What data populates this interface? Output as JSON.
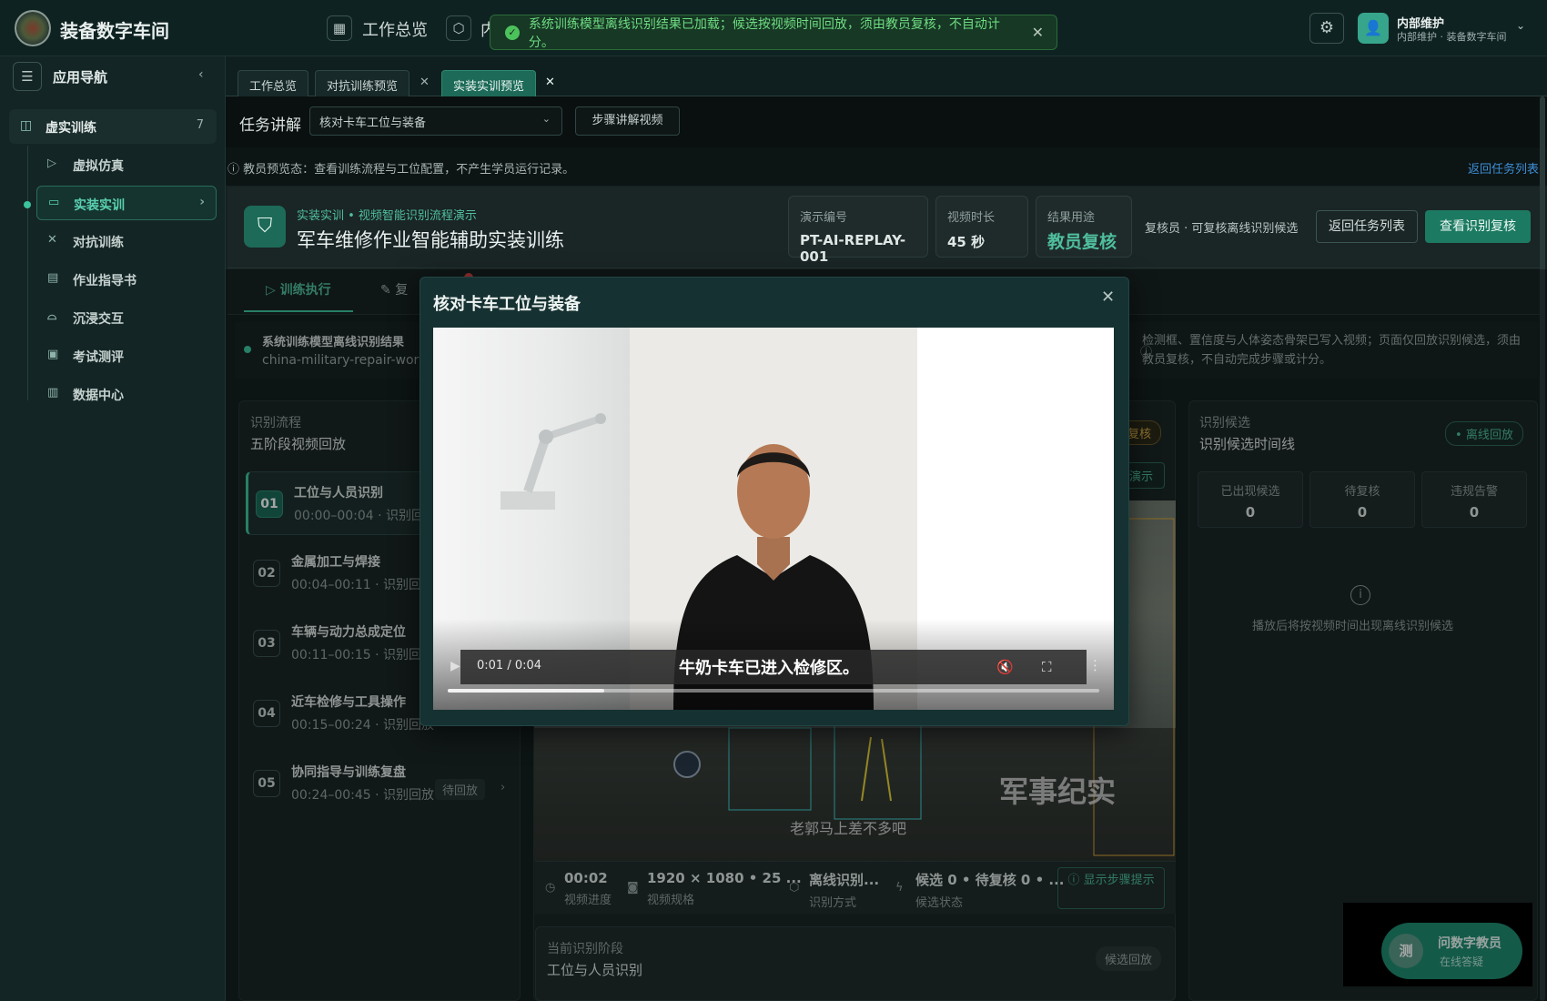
{
  "app": {
    "brand": "装备数字车间"
  },
  "topnav": {
    "overview": "工作总览",
    "internal_partial": "内"
  },
  "toast": {
    "message": "系统训练模型离线识别结果已加载；候选按视频时间回放，须由教员复核，不自动计分。"
  },
  "user": {
    "name": "内部维护",
    "sub": "内部维护 · 装备数字车间"
  },
  "sidebar": {
    "title": "应用导航",
    "group": {
      "label": "虚实训练",
      "count": "7"
    },
    "items": [
      {
        "label": "虚拟仿真"
      },
      {
        "label": "实装实训"
      },
      {
        "label": "对抗训练"
      },
      {
        "label": "作业指导书"
      },
      {
        "label": "沉浸交互"
      },
      {
        "label": "考试测评"
      },
      {
        "label": "数据中心"
      }
    ]
  },
  "tabs": [
    {
      "label": "工作总览"
    },
    {
      "label": "对抗训练预览"
    },
    {
      "label": "实装实训预览"
    }
  ],
  "task": {
    "label": "任务讲解",
    "selected": "核对卡车工位与装备",
    "step_video_btn": "步骤讲解视频"
  },
  "infobar": {
    "text": "教员预览态：查看训练流程与工位配置，不产生学员运行记录。",
    "link": "返回任务列表"
  },
  "header": {
    "crumb": "实装实训 • 视频智能识别流程演示",
    "title": "军车维修作业智能辅助实装训练",
    "stats": [
      {
        "k": "演示编号",
        "v": "PT-AI-REPLAY-001"
      },
      {
        "k": "视频时长",
        "v": "45 秒"
      },
      {
        "k": "结果用途",
        "v": "教员复核"
      }
    ],
    "reviewer": "复核员 · 可复核离线识别候选",
    "back_btn": "返回任务列表",
    "review_btn": "查看识别复核"
  },
  "subtabs": {
    "exec": "训练执行",
    "review_partial": "复"
  },
  "notice": {
    "title": "系统训练模型离线识别结果",
    "sub": "china-military-repair-work",
    "right": "检测框、置信度与人体姿态骨架已写入视频；页面仅回放识别候选，须由教员复核，不自动完成步骤或计分。"
  },
  "flow": {
    "k": "识别流程",
    "v": "五阶段视频回放",
    "steps": [
      {
        "num": "01",
        "name": "工位与人员识别",
        "time": "00:00–00:04 · 识别回放"
      },
      {
        "num": "02",
        "name": "金属加工与焊接",
        "time": "00:04–00:11 · 识别回放"
      },
      {
        "num": "03",
        "name": "车辆与动力总成定位",
        "time": "00:11–00:15 · 识别回放"
      },
      {
        "num": "04",
        "name": "近车检修与工具操作",
        "time": "00:15–00:24 · 识别回放"
      },
      {
        "num": "05",
        "name": "协同指导与训练复盘",
        "time": "00:24–00:45 · 识别回放",
        "pending": "待回放"
      }
    ]
  },
  "video": {
    "badge_review": "复核",
    "badge_demo": "演示",
    "watermark": "军事纪实",
    "subtitle": "老郭马上差不多吧",
    "meta": [
      {
        "v": "00:02",
        "k": "视频进度"
      },
      {
        "v": "1920 × 1080 • 25 ...",
        "k": "视频规格"
      },
      {
        "v": "离线识别...",
        "k": "识别方式"
      },
      {
        "v": "候选 0 • 待复核 0 • ...",
        "k": "候选状态"
      }
    ],
    "show_btn": "显示步骤提示"
  },
  "stage": {
    "k": "当前识别阶段",
    "v": "工位与人员识别",
    "badge": "候选回放"
  },
  "candidates": {
    "k": "识别候选",
    "v": "识别候选时间线",
    "badge": "离线回放",
    "counts": [
      {
        "k": "已出现候选",
        "v": "0"
      },
      {
        "k": "待复核",
        "v": "0"
      },
      {
        "k": "违规告警",
        "v": "0"
      }
    ],
    "empty": "播放后将按视频时间出现离线识别候选"
  },
  "assistant": {
    "avatar": "测",
    "name": "问数字教员",
    "status": "在线答疑"
  },
  "modal": {
    "title": "核对卡车工位与装备",
    "time": "0:01 / 0:04",
    "caption": "牛奶卡车已进入检修区。",
    "progress": 0.24
  }
}
